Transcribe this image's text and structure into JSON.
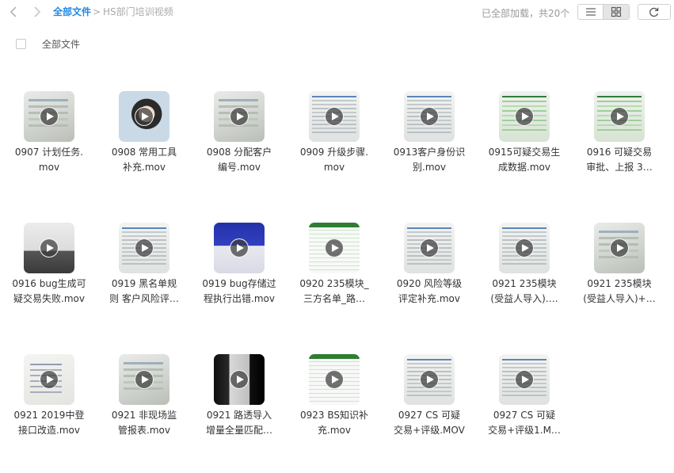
{
  "toolbar": {
    "back_icon": "chevron-left-icon",
    "forward_icon": "chevron-right-icon",
    "breadcrumb": {
      "root": "全部文件",
      "separator": ">",
      "current": "HS部门培训视频"
    },
    "status": "已全部加载，共20个",
    "view_list_icon": "list-view-icon",
    "view_grid_icon": "grid-view-icon",
    "refresh_icon": "refresh-icon",
    "active_view": "grid"
  },
  "select_all": {
    "label": "全部文件",
    "checked": false
  },
  "colors": {
    "accent": "#1e88e5",
    "muted": "#999999"
  },
  "files": [
    {
      "line1": "0907 计划任务.",
      "line2": "mov",
      "thumb": "paper"
    },
    {
      "line1": "0908 常用工具",
      "line2": "补充.mov",
      "thumb": "portrait"
    },
    {
      "line1": "0908 分配客户",
      "line2": "编号.mov",
      "thumb": "paper"
    },
    {
      "line1": "0909 升级步骤.",
      "line2": "mov",
      "thumb": "screen"
    },
    {
      "line1": "0913客户身份识",
      "line2": "别.mov",
      "thumb": "screen"
    },
    {
      "line1": "0915可疑交易生",
      "line2": "成数据.mov",
      "thumb": "green"
    },
    {
      "line1": "0916 可疑交易",
      "line2": "审批、上报 3…",
      "thumb": "green"
    },
    {
      "line1": "0916 bug生成可",
      "line2": "疑交易失败.mov",
      "thumb": "laptop"
    },
    {
      "line1": "0919 黑名单规",
      "line2": "则 客户风险评…",
      "thumb": "screen"
    },
    {
      "line1": "0919 bug存储过",
      "line2": "程执行出错.mov",
      "thumb": "blue"
    },
    {
      "line1": "0920 235模块_",
      "line2": "三方名单_路…",
      "thumb": "sheet"
    },
    {
      "line1": "0920 风险等级",
      "line2": "评定补充.mov",
      "thumb": "screen"
    },
    {
      "line1": "0921 235模块",
      "line2": "(受益人导入)….",
      "thumb": "screen"
    },
    {
      "line1": "0921 235模块",
      "line2": "(受益人导入)+…",
      "thumb": "paper"
    },
    {
      "line1": "0921 2019中登",
      "line2": "接口改造.mov",
      "thumb": "note"
    },
    {
      "line1": "0921 非现场监",
      "line2": "管报表.mov",
      "thumb": "paper"
    },
    {
      "line1": "0921 路透导入",
      "line2": "增量全量匹配…",
      "thumb": "dark"
    },
    {
      "line1": "0923 BS知识补",
      "line2": "充.mov",
      "thumb": "sheet"
    },
    {
      "line1": "0927 CS 可疑",
      "line2": "交易+评级.MOV",
      "thumb": "screen"
    },
    {
      "line1": "0927 CS 可疑",
      "line2": "交易+评级1.M…",
      "thumb": "screen"
    }
  ]
}
